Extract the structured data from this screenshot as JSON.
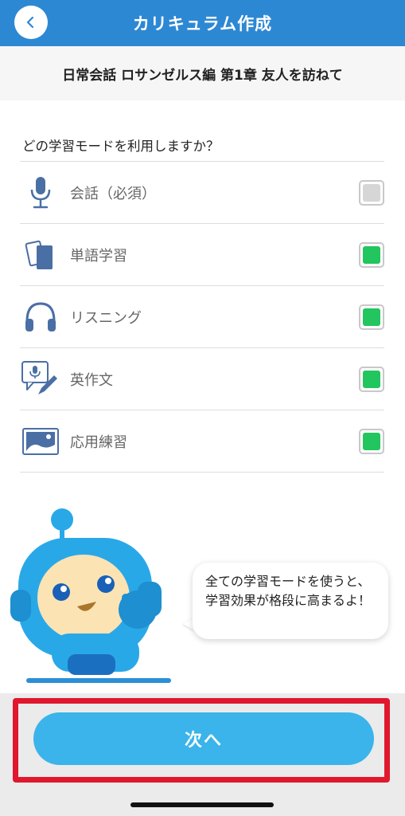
{
  "header": {
    "title": "カリキュラム作成",
    "back_icon": "chevron-left-icon"
  },
  "subheader": {
    "title": "日常会話 ロサンゼルス編 第1章 友人を訪ねて"
  },
  "question": "どの学習モードを利用しますか？",
  "modes": [
    {
      "label": "会話（必須）",
      "icon": "microphone-icon",
      "checked": true,
      "disabled": true
    },
    {
      "label": "単語学習",
      "icon": "word-cards-icon",
      "checked": true,
      "disabled": false
    },
    {
      "label": "リスニング",
      "icon": "headphones-icon",
      "checked": true,
      "disabled": false
    },
    {
      "label": "英作文",
      "icon": "composition-pen-icon",
      "checked": true,
      "disabled": false
    },
    {
      "label": "応用練習",
      "icon": "image-practice-icon",
      "checked": true,
      "disabled": false
    }
  ],
  "mascot": {
    "speech": "全ての学習モードを使うと、学習効果が格段に高まるよ！"
  },
  "footer": {
    "next_label": "次へ"
  },
  "colors": {
    "header_bg": "#2d88d4",
    "check_active": "#22c55e",
    "check_disabled": "#d6d6d6",
    "next_button": "#3ab4ea",
    "highlight": "#e0182d",
    "icon_color": "#4a6fa5"
  }
}
